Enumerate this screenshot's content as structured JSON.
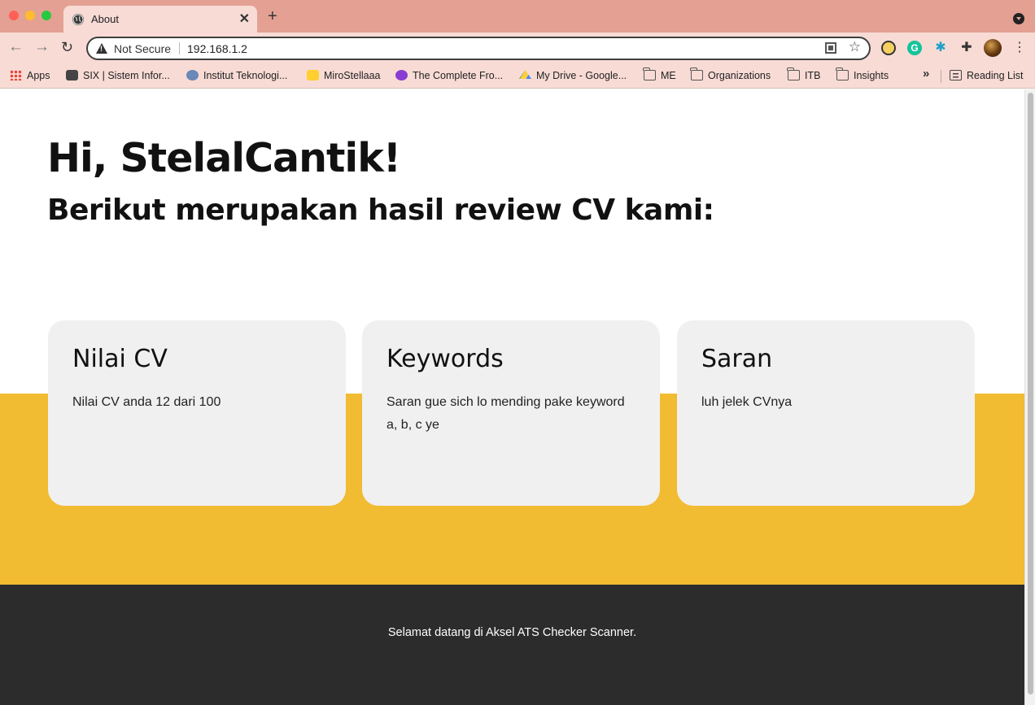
{
  "browser": {
    "tab_title": "About",
    "tab_close": "✕",
    "new_tab": "+",
    "security_label": "Not Secure",
    "url": "192.168.1.2",
    "bookmarks": [
      {
        "label": "Apps",
        "icon": "apps-grid-icon"
      },
      {
        "label": "SIX | Sistem Infor...",
        "icon": "six-favicon"
      },
      {
        "label": "Institut Teknologi...",
        "icon": "itb-favicon"
      },
      {
        "label": "MiroStellaaa",
        "icon": "miro-favicon"
      },
      {
        "label": "The Complete Fro...",
        "icon": "frontend-favicon"
      },
      {
        "label": "My Drive - Google...",
        "icon": "google-drive-icon"
      },
      {
        "label": "ME",
        "icon": "folder-icon"
      },
      {
        "label": "Organizations",
        "icon": "folder-icon"
      },
      {
        "label": "ITB",
        "icon": "folder-icon"
      },
      {
        "label": "Insights",
        "icon": "folder-icon"
      }
    ],
    "more_bookmarks": "»",
    "reading_list": "Reading List"
  },
  "page": {
    "greeting": "Hi, StelalCantik!",
    "subtitle": "Berikut merupakan hasil review CV kami:",
    "cards": [
      {
        "title": "Nilai CV",
        "body": "Nilai CV anda 12 dari 100"
      },
      {
        "title": "Keywords",
        "body": "Saran gue sich lo mending pake keyword a, b, c ye"
      },
      {
        "title": "Saran",
        "body": "luh jelek CVnya"
      }
    ],
    "footer": "Selamat datang di Aksel ATS Checker Scanner."
  },
  "colors": {
    "accent_band": "#f1bb32",
    "footer_bg": "#2c2c2c",
    "card_bg": "#f0f0f0",
    "chrome_tab_strip": "#e3a093"
  }
}
